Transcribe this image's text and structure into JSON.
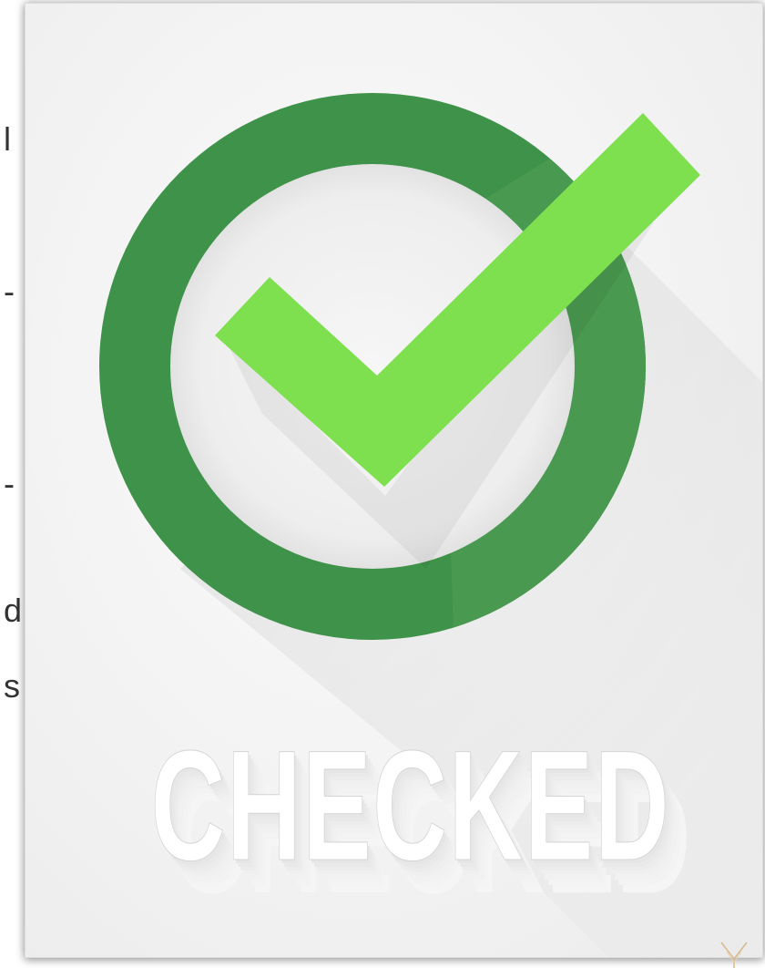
{
  "left_column": {
    "fragments": [
      "l",
      "-",
      "-",
      "d",
      "s"
    ]
  },
  "poster": {
    "label": "CHECKED",
    "colors": {
      "ring": "#3f9249",
      "ring_shadow": "#4a9a52",
      "check": "#7ee04f",
      "background": "#f4f4f4",
      "inner_disc": "#f2f2f2",
      "text": "#ffffff"
    },
    "icons": [
      "circle-ring-icon",
      "checkmark-icon"
    ]
  },
  "watermark": {
    "icon": "star-logo-icon"
  }
}
